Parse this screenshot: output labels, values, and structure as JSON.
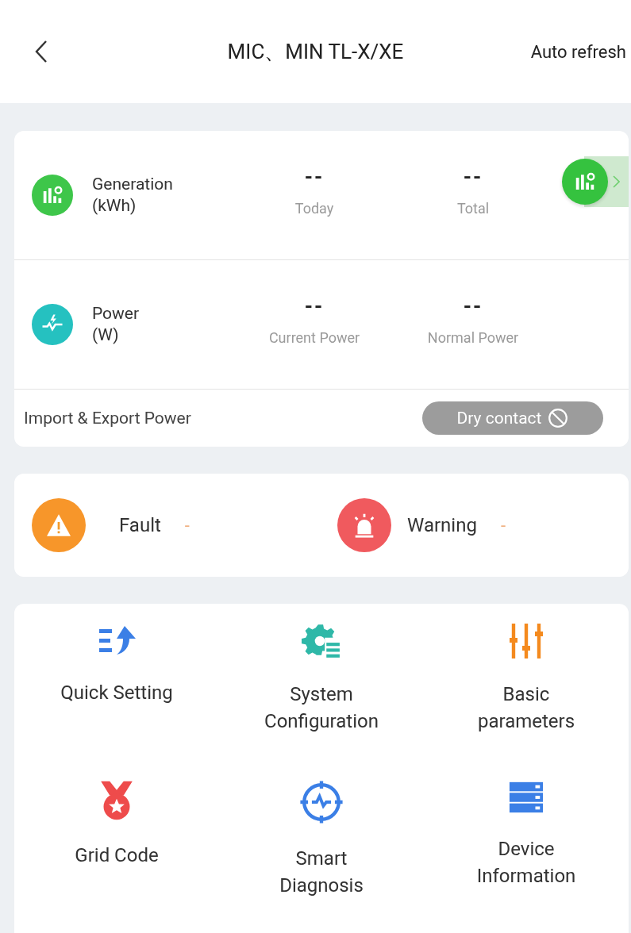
{
  "header": {
    "title": "MIC、MIN TL-X/XE",
    "action": "Auto refresh"
  },
  "summary": {
    "rows": [
      {
        "kind": "generation",
        "label": "Generation",
        "unit": "(kWh)",
        "stats": [
          {
            "value": "--",
            "label": "Today"
          },
          {
            "value": "--",
            "label": "Total"
          }
        ],
        "shortcut": true
      },
      {
        "kind": "power",
        "label": "Power",
        "unit": "(W)",
        "stats": [
          {
            "value": "--",
            "label": "Current Power"
          },
          {
            "value": "--",
            "label": "Normal Power"
          }
        ],
        "shortcut": false
      }
    ],
    "footer": {
      "label": "Import & Export Power",
      "button": {
        "label": "Dry contact",
        "disabled": true
      }
    }
  },
  "alerts": [
    {
      "kind": "fault",
      "label": "Fault",
      "value": "-"
    },
    {
      "kind": "warning",
      "label": "Warning",
      "value": "-"
    }
  ],
  "menu": [
    {
      "kind": "quick",
      "label": "Quick Setting"
    },
    {
      "kind": "system",
      "label": "System Configuration"
    },
    {
      "kind": "basic",
      "label": "Basic parameters"
    },
    {
      "kind": "grid",
      "label": "Grid Code"
    },
    {
      "kind": "diagnosis",
      "label": "Smart Diagnosis"
    },
    {
      "kind": "device",
      "label": "Device Information"
    }
  ]
}
